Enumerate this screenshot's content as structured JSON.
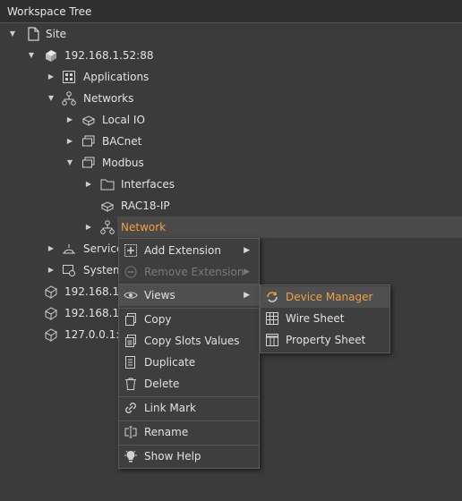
{
  "panel": {
    "title": "Workspace Tree"
  },
  "tree": {
    "site": "Site",
    "station_main": "192.168.1.52:88",
    "applications": "Applications",
    "networks": "Networks",
    "local_io": "Local IO",
    "bacnet": "BACnet",
    "modbus": "Modbus",
    "interfaces": "Interfaces",
    "rac18": "RAC18-IP",
    "network": "Network",
    "services": "Services",
    "system": "System",
    "station_2": "192.168.1.1",
    "station_3": "192.168.1.5",
    "station_4": "127.0.0.1:1"
  },
  "context_menu": {
    "add_extension": "Add Extension",
    "remove_extension": "Remove Extension",
    "views": "Views",
    "copy": "Copy",
    "copy_slots_values": "Copy Slots Values",
    "duplicate": "Duplicate",
    "delete": "Delete",
    "link_mark": "Link Mark",
    "rename": "Rename",
    "show_help": "Show Help"
  },
  "views_submenu": {
    "device_manager": "Device Manager",
    "wire_sheet": "Wire Sheet",
    "property_sheet": "Property Sheet"
  },
  "colors": {
    "accent": "#f0a040",
    "background": "#3b3b3b",
    "highlight": "#4a4a4a"
  }
}
